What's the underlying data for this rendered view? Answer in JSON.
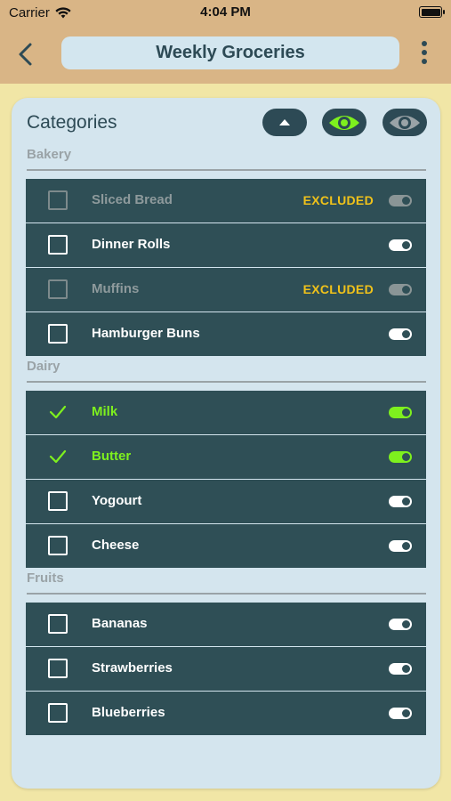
{
  "status_bar": {
    "carrier": "Carrier",
    "time": "4:04 PM"
  },
  "nav": {
    "title": "Weekly Groceries"
  },
  "panel": {
    "title": "Categories"
  },
  "colors": {
    "accent_green": "#7ef01e",
    "excluded_yellow": "#f0c21a",
    "row_bg": "#2f4f56",
    "nav_bg": "#d9b586"
  },
  "icons": {
    "back": "chevron-left-icon",
    "more": "vertical-ellipsis-icon",
    "collapse": "caret-up-icon",
    "show": "eye-icon",
    "hide": "eye-icon"
  },
  "sections": [
    {
      "name": "Bakery",
      "items": [
        {
          "label": "Sliced Bread",
          "state": "excluded",
          "tag": "EXCLUDED"
        },
        {
          "label": "Dinner Rolls",
          "state": "unchecked",
          "tag": ""
        },
        {
          "label": "Muffins",
          "state": "excluded",
          "tag": "EXCLUDED"
        },
        {
          "label": "Hamburger Buns",
          "state": "unchecked",
          "tag": ""
        }
      ]
    },
    {
      "name": "Dairy",
      "items": [
        {
          "label": "Milk",
          "state": "checked",
          "tag": ""
        },
        {
          "label": "Butter",
          "state": "checked",
          "tag": ""
        },
        {
          "label": "Yogourt",
          "state": "unchecked",
          "tag": ""
        },
        {
          "label": "Cheese",
          "state": "unchecked",
          "tag": ""
        }
      ]
    },
    {
      "name": "Fruits",
      "items": [
        {
          "label": "Bananas",
          "state": "unchecked",
          "tag": ""
        },
        {
          "label": "Strawberries",
          "state": "unchecked",
          "tag": ""
        },
        {
          "label": "Blueberries",
          "state": "unchecked",
          "tag": ""
        }
      ]
    }
  ]
}
